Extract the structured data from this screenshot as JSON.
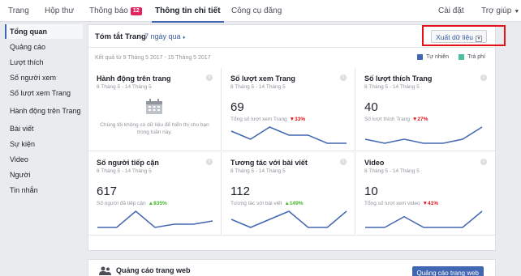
{
  "topnav": {
    "tabs": [
      {
        "label": "Trang"
      },
      {
        "label": "Hộp thư"
      },
      {
        "label": "Thông báo",
        "badge": "12"
      },
      {
        "label": "Thông tin chi tiết",
        "active": true
      },
      {
        "label": "Công cụ đăng"
      }
    ],
    "settings": "Cài đặt",
    "help": "Trợ giúp"
  },
  "sidebar": {
    "items": [
      {
        "label": "Tổng quan",
        "active": true
      },
      {
        "label": "Quảng cáo"
      },
      {
        "label": "Lượt thích"
      },
      {
        "label": "Số người xem"
      },
      {
        "label": "Số lượt xem Trang"
      },
      {
        "label": "Hành động trên Trang"
      },
      {
        "label": "Bài viết"
      },
      {
        "label": "Sự kiện"
      },
      {
        "label": "Video"
      },
      {
        "label": "Người"
      },
      {
        "label": "Tin nhắn"
      }
    ]
  },
  "summary": {
    "title": "Tóm tắt Trang",
    "range": "7 ngày qua",
    "export": "Xuất dữ liệu",
    "results_range": "Kết quả từ 9 Tháng 5 2017 - 15 Tháng 5 2017",
    "legend": [
      {
        "label": "Tự nhiên",
        "color": "#4267b2"
      },
      {
        "label": "Trả phí",
        "color": "#4bc0a1"
      }
    ]
  },
  "cards": [
    {
      "title": "Hành động trên trang",
      "dates": "8 Tháng 5 - 14 Tháng 5",
      "no_data": "Chúng tôi không có dữ liệu để hiển thị cho bạn trong tuần này."
    },
    {
      "title": "Số lượt xem Trang",
      "dates": "8 Tháng 5 - 14 Tháng 5",
      "value": "69",
      "sub": "Tổng số lượt xem Trang",
      "change": "33%",
      "direction": "down",
      "spark": [
        6,
        4,
        7,
        5,
        5,
        3,
        3
      ]
    },
    {
      "title": "Số lượt thích Trang",
      "dates": "8 Tháng 5 - 14 Tháng 5",
      "value": "40",
      "sub": "Số lượt thích Trang",
      "change": "27%",
      "direction": "down",
      "spark": [
        5,
        4,
        5,
        4,
        4,
        5,
        8
      ]
    },
    {
      "title": "Số người tiếp cận",
      "dates": "8 Tháng 5 - 14 Tháng 5",
      "value": "617",
      "sub": "Số người đã tiếp cận",
      "change": "835%",
      "direction": "up",
      "spark": [
        1,
        1,
        6,
        1,
        2,
        2,
        3
      ]
    },
    {
      "title": "Tương tác với bài viết",
      "dates": "8 Tháng 5 - 14 Tháng 5",
      "value": "112",
      "sub": "Tương tác với bài viết",
      "change": "149%",
      "direction": "up",
      "spark": [
        2,
        1,
        2,
        3,
        1,
        1,
        3
      ]
    },
    {
      "title": "Video",
      "dates": "8 Tháng 5 - 14 Tháng 5",
      "value": "10",
      "sub": "Tổng số lượt xem video",
      "change": "41%",
      "direction": "down",
      "spark": [
        1,
        1,
        3,
        1,
        1,
        1,
        4
      ]
    }
  ],
  "ad": {
    "title": "Quảng cáo trang web",
    "button": "Quảng cáo trang web"
  }
}
